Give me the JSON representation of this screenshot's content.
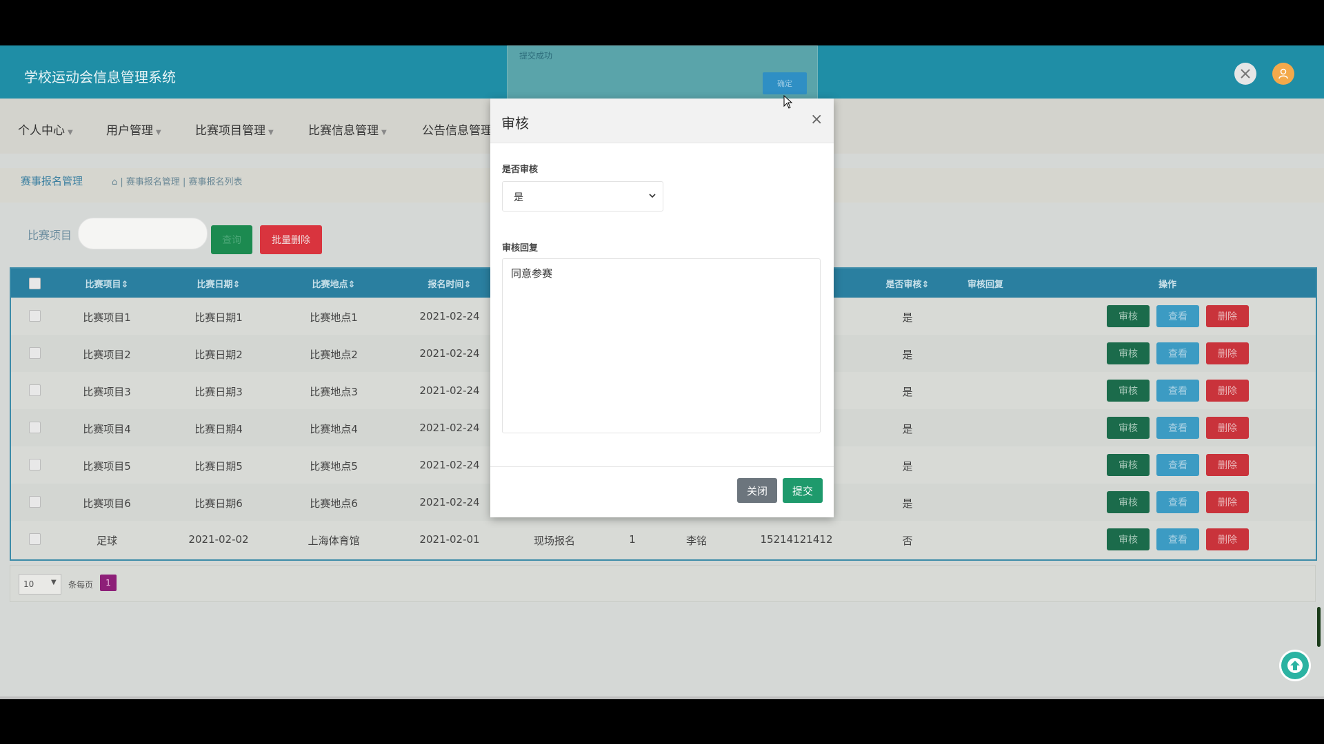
{
  "header": {
    "title": "学校运动会信息管理系统"
  },
  "nav": {
    "items": [
      {
        "label": "个人中心"
      },
      {
        "label": "用户管理"
      },
      {
        "label": "比赛项目管理"
      },
      {
        "label": "比赛信息管理"
      },
      {
        "label": "公告信息管理"
      }
    ]
  },
  "breadcrumb": {
    "title": "赛事报名管理",
    "path": "| 赛事报名管理 | 赛事报名列表"
  },
  "search": {
    "label": "比赛项目",
    "value": "",
    "search_label": "查询",
    "batch_delete_label": "批量删除"
  },
  "table": {
    "headers": [
      "比赛项目",
      "比赛日期",
      "比赛地点",
      "报名时间",
      "是否审核",
      "审核回复",
      "操作"
    ],
    "rows": [
      {
        "c": [
          "比赛项目1",
          "比赛日期1",
          "比赛地点1",
          "2021-02-24",
          "",
          "",
          "",
          "",
          "是",
          ""
        ]
      },
      {
        "c": [
          "比赛项目2",
          "比赛日期2",
          "比赛地点2",
          "2021-02-24",
          "",
          "",
          "",
          "",
          "是",
          ""
        ]
      },
      {
        "c": [
          "比赛项目3",
          "比赛日期3",
          "比赛地点3",
          "2021-02-24",
          "",
          "",
          "",
          "",
          "是",
          ""
        ]
      },
      {
        "c": [
          "比赛项目4",
          "比赛日期4",
          "比赛地点4",
          "2021-02-24",
          "",
          "",
          "",
          "",
          "是",
          ""
        ]
      },
      {
        "c": [
          "比赛项目5",
          "比赛日期5",
          "比赛地点5",
          "2021-02-24",
          "",
          "",
          "",
          "",
          "是",
          ""
        ]
      },
      {
        "c": [
          "比赛项目6",
          "比赛日期6",
          "比赛地点6",
          "2021-02-24",
          "",
          "",
          "",
          "",
          "是",
          ""
        ]
      },
      {
        "c": [
          "足球",
          "2021-02-02",
          "上海体育馆",
          "2021-02-01",
          "现场报名",
          "1",
          "李铭",
          "15214121412",
          "否",
          ""
        ]
      }
    ],
    "actions": {
      "review": "审核",
      "view": "查看",
      "delete": "删除"
    }
  },
  "pager": {
    "per_page_value": "10",
    "per_page_label": "条每页",
    "current_page": "1"
  },
  "toast": {
    "message": "提交成功",
    "ok_label": "确定"
  },
  "modal": {
    "title": "审核",
    "close_symbol": "×",
    "field1_label": "是否审核",
    "field1_value": "是",
    "field2_label": "审核回复",
    "field2_value": "同意参赛",
    "close_label": "关闭",
    "submit_label": "提交"
  },
  "colors": {
    "header": "#1f8ea6",
    "review": "#1b6b4b",
    "view": "#3c9bc3",
    "delete": "#c9333b",
    "submit": "#1e9a6c"
  }
}
